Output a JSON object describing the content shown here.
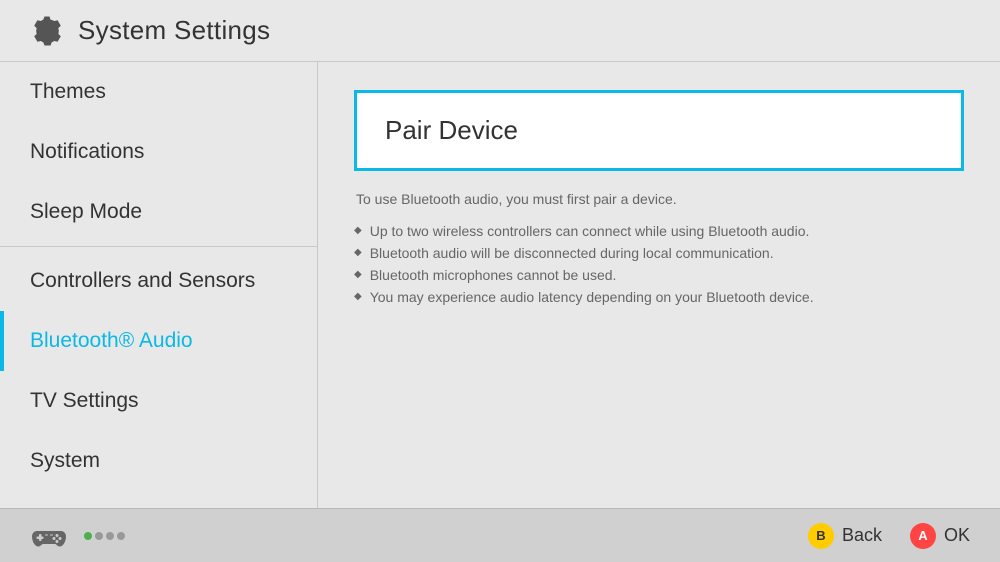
{
  "header": {
    "title": "System Settings",
    "icon": "gear"
  },
  "sidebar": {
    "items": [
      {
        "id": "themes",
        "label": "Themes",
        "active": false,
        "divider_after": false
      },
      {
        "id": "notifications",
        "label": "Notifications",
        "active": false,
        "divider_after": false
      },
      {
        "id": "sleep-mode",
        "label": "Sleep Mode",
        "active": false,
        "divider_after": true
      },
      {
        "id": "controllers-sensors",
        "label": "Controllers and Sensors",
        "active": false,
        "divider_after": false
      },
      {
        "id": "bluetooth-audio",
        "label": "Bluetooth® Audio",
        "active": true,
        "divider_after": false
      },
      {
        "id": "tv-settings",
        "label": "TV Settings",
        "active": false,
        "divider_after": false
      },
      {
        "id": "system",
        "label": "System",
        "active": false,
        "divider_after": false
      }
    ]
  },
  "content": {
    "pair_device_label": "Pair Device",
    "description": "To use Bluetooth audio, you must first pair a device.",
    "bullets": [
      "Up to two wireless controllers can connect while using Bluetooth audio.",
      "Bluetooth audio will be disconnected during local communication.",
      "Bluetooth microphones cannot be used.",
      "You may experience audio latency depending on your Bluetooth device."
    ]
  },
  "footer": {
    "back_label": "Back",
    "ok_label": "OK",
    "back_btn": "B",
    "ok_btn": "A"
  }
}
